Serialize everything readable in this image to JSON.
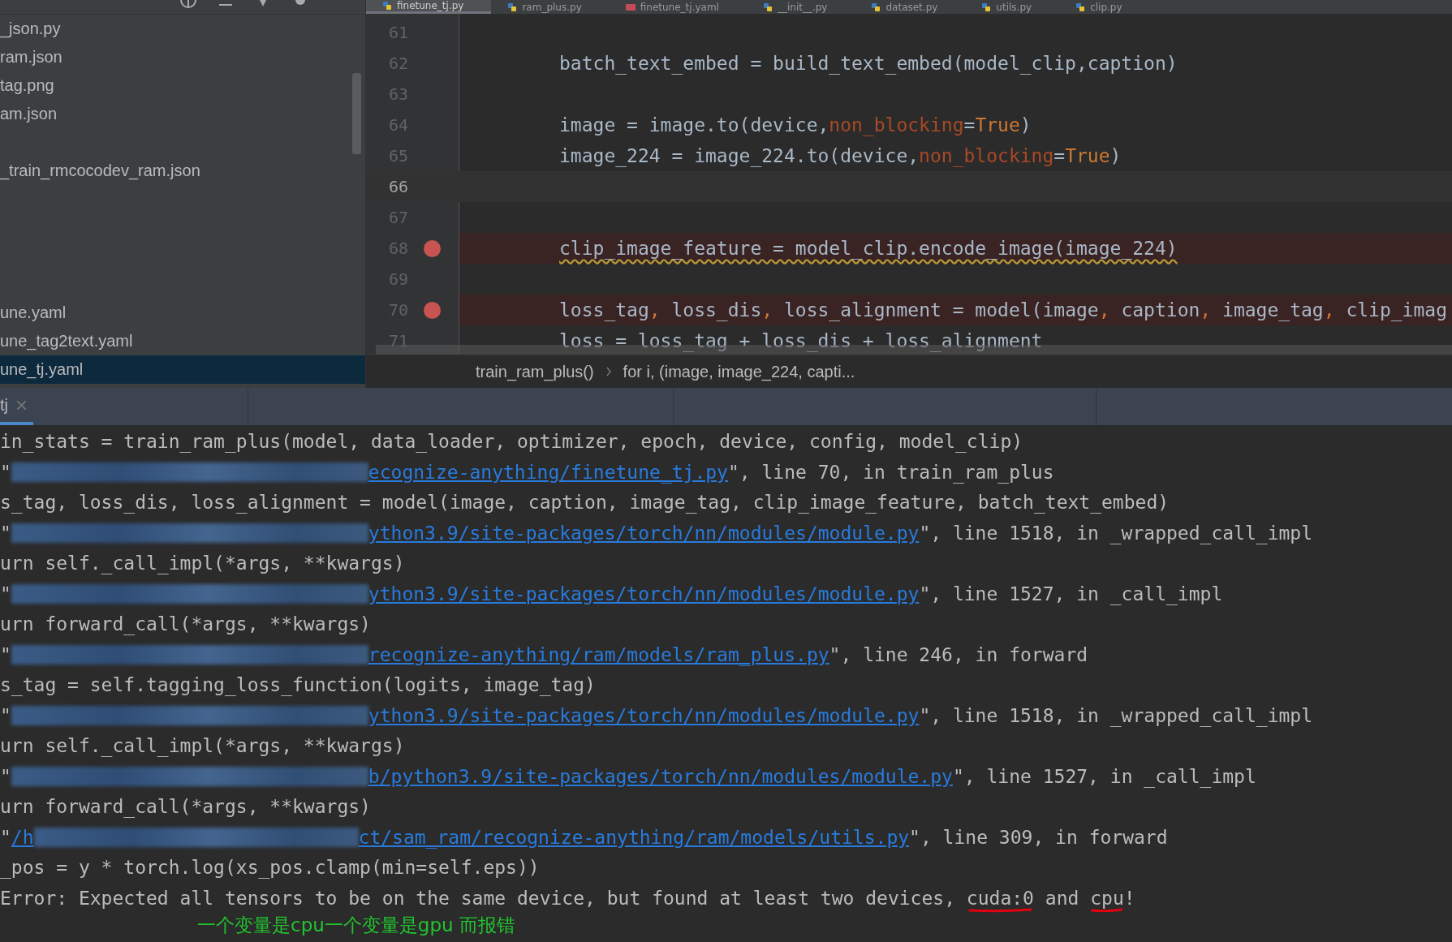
{
  "project_panel": {
    "items": [
      {
        "label": "_json.py",
        "selected": false
      },
      {
        "label": "ram.json",
        "selected": false
      },
      {
        "label": "tag.png",
        "selected": false
      },
      {
        "label": "am.json",
        "selected": false
      },
      {
        "label": "_train_rmcocodev_ram.json",
        "selected": false
      },
      {
        "label": "une.yaml",
        "selected": false
      },
      {
        "label": "une_tag2text.yaml",
        "selected": false
      },
      {
        "label": "une_tj.yaml",
        "selected": true
      }
    ]
  },
  "editor_tabs": [
    {
      "label": "finetune_tj.py",
      "kind": "py",
      "selected": true
    },
    {
      "label": "ram_plus.py",
      "kind": "py",
      "selected": false
    },
    {
      "label": "finetune_tj.yaml",
      "kind": "yaml",
      "selected": false
    },
    {
      "label": "__init__.py",
      "kind": "py",
      "selected": false
    },
    {
      "label": "dataset.py",
      "kind": "py",
      "selected": false
    },
    {
      "label": "utils.py",
      "kind": "py",
      "selected": false
    },
    {
      "label": "clip.py",
      "kind": "py",
      "selected": false
    }
  ],
  "editor": {
    "lines": [
      {
        "number": "61",
        "current": false,
        "breakpoint": false
      },
      {
        "number": "62",
        "current": false,
        "breakpoint": false,
        "tokens": [
          {
            "text": "batch_text_embed = build_text_embed(model_clip,caption)",
            "kind": "plain"
          }
        ]
      },
      {
        "number": "63",
        "current": false,
        "breakpoint": false
      },
      {
        "number": "64",
        "current": false,
        "breakpoint": false,
        "tokens": [
          {
            "text": "image = image.to(device,",
            "kind": "plain"
          },
          {
            "text": "non_blocking",
            "kind": "param"
          },
          {
            "text": "=",
            "kind": "plain"
          },
          {
            "text": "True",
            "kind": "keyword"
          },
          {
            "text": ")",
            "kind": "plain"
          }
        ]
      },
      {
        "number": "65",
        "current": false,
        "breakpoint": false,
        "tokens": [
          {
            "text": "image_224 = image_224.to(device,",
            "kind": "plain"
          },
          {
            "text": "non_blocking",
            "kind": "param"
          },
          {
            "text": "=",
            "kind": "plain"
          },
          {
            "text": "True",
            "kind": "keyword"
          },
          {
            "text": ")",
            "kind": "plain"
          }
        ]
      },
      {
        "number": "66",
        "current": true,
        "breakpoint": false
      },
      {
        "number": "67",
        "current": false,
        "breakpoint": false
      },
      {
        "number": "68",
        "current": false,
        "breakpoint": true,
        "warning": true,
        "tokens": [
          {
            "text": "clip_image_feature = model_clip.encode_image(image_224)",
            "kind": "plain"
          }
        ]
      },
      {
        "number": "69",
        "current": false,
        "breakpoint": false
      },
      {
        "number": "70",
        "current": false,
        "breakpoint": true,
        "tokens": [
          {
            "text": "loss_tag",
            "kind": "plain"
          },
          {
            "text": ", ",
            "kind": "keyword"
          },
          {
            "text": "loss_dis",
            "kind": "plain"
          },
          {
            "text": ", ",
            "kind": "keyword"
          },
          {
            "text": "loss_alignment = model(image",
            "kind": "plain"
          },
          {
            "text": ", ",
            "kind": "keyword"
          },
          {
            "text": "caption",
            "kind": "plain"
          },
          {
            "text": ", ",
            "kind": "keyword"
          },
          {
            "text": "image_tag",
            "kind": "plain"
          },
          {
            "text": ", ",
            "kind": "keyword"
          },
          {
            "text": "clip_imag",
            "kind": "plain"
          }
        ]
      },
      {
        "number": "71",
        "current": false,
        "breakpoint": false,
        "tokens": [
          {
            "text": "loss = loss_tag + loss_dis + loss_alignment",
            "kind": "plain"
          }
        ]
      }
    ],
    "breadcrumbs": [
      "train_ram_plus()",
      "for i, (image, image_224, capti..."
    ]
  },
  "run_tabs": [
    {
      "label": "tj",
      "selected": true
    }
  ],
  "console": {
    "lines": [
      {
        "parts": [
          {
            "kind": "plain",
            "text": "in_stats = train_ram_plus(model, data_loader, optimizer, epoch, device, config, model_clip)"
          }
        ]
      },
      {
        "parts": [
          {
            "kind": "plain",
            "text": "\""
          },
          {
            "kind": "blur"
          },
          {
            "kind": "link",
            "text": "ecognize-anything/finetune_tj.py"
          },
          {
            "kind": "plain",
            "text": "\", line 70, in train_ram_plus"
          }
        ]
      },
      {
        "parts": [
          {
            "kind": "plain",
            "text": "s_tag, loss_dis, loss_alignment = model(image, caption, image_tag, clip_image_feature, batch_text_embed)"
          }
        ]
      },
      {
        "parts": [
          {
            "kind": "plain",
            "text": "\""
          },
          {
            "kind": "blur"
          },
          {
            "kind": "link",
            "text": "ython3.9/site-packages/torch/nn/modules/module.py"
          },
          {
            "kind": "plain",
            "text": "\", line 1518, in _wrapped_call_impl"
          }
        ]
      },
      {
        "parts": [
          {
            "kind": "plain",
            "text": "urn self._call_impl(*args, **kwargs)"
          }
        ]
      },
      {
        "parts": [
          {
            "kind": "plain",
            "text": "\""
          },
          {
            "kind": "blur"
          },
          {
            "kind": "link",
            "text": "ython3.9/site-packages/torch/nn/modules/module.py"
          },
          {
            "kind": "plain",
            "text": "\", line 1527, in _call_impl"
          }
        ]
      },
      {
        "parts": [
          {
            "kind": "plain",
            "text": "urn forward_call(*args, **kwargs)"
          }
        ]
      },
      {
        "parts": [
          {
            "kind": "plain",
            "text": "\""
          },
          {
            "kind": "blur"
          },
          {
            "kind": "link",
            "text": "recognize-anything/ram/models/ram_plus.py"
          },
          {
            "kind": "plain",
            "text": "\", line 246, in forward"
          }
        ]
      },
      {
        "parts": [
          {
            "kind": "plain",
            "text": "s_tag = self.tagging_loss_function(logits, image_tag)"
          }
        ]
      },
      {
        "parts": [
          {
            "kind": "plain",
            "text": "\""
          },
          {
            "kind": "blur"
          },
          {
            "kind": "link",
            "text": "ython3.9/site-packages/torch/nn/modules/module.py"
          },
          {
            "kind": "plain",
            "text": "\", line 1518, in _wrapped_call_impl"
          }
        ]
      },
      {
        "parts": [
          {
            "kind": "plain",
            "text": "urn self._call_impl(*args, **kwargs)"
          }
        ]
      },
      {
        "parts": [
          {
            "kind": "plain",
            "text": "\""
          },
          {
            "kind": "blur"
          },
          {
            "kind": "link",
            "text": "b/python3.9/site-packages/torch/nn/modules/module.py"
          },
          {
            "kind": "plain",
            "text": "\", line 1527, in _call_impl"
          }
        ]
      },
      {
        "parts": [
          {
            "kind": "plain",
            "text": "urn forward_call(*args, **kwargs)"
          }
        ]
      },
      {
        "parts": [
          {
            "kind": "plain",
            "text": "\""
          },
          {
            "kind": "link",
            "text": "/h"
          },
          {
            "kind": "blur"
          },
          {
            "kind": "link",
            "text": "ct/sam_ram/recognize-anything/ram/models/utils.py"
          },
          {
            "kind": "plain",
            "text": "\", line 309, in forward"
          }
        ]
      },
      {
        "parts": [
          {
            "kind": "plain",
            "text": "_pos = y * torch.log(xs_pos.clamp(min=self.eps))"
          }
        ]
      },
      {
        "parts": [
          {
            "kind": "plain",
            "text": "Error: Expected all tensors to be on the same device, but found at least two devices, "
          },
          {
            "kind": "marked",
            "text": "cuda:0"
          },
          {
            "kind": "plain",
            "text": " and "
          },
          {
            "kind": "marked",
            "text": "cpu"
          },
          {
            "kind": "plain",
            "text": "!"
          }
        ]
      }
    ]
  },
  "annotation": "一个变量是cpu一个变量是gpu 而报错"
}
